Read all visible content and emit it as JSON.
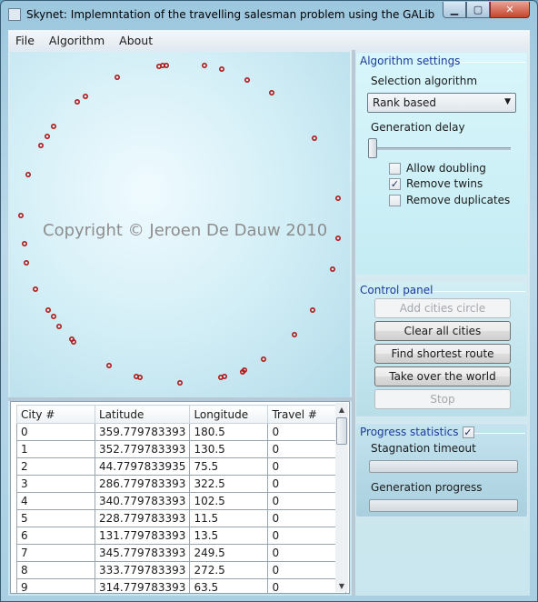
{
  "window": {
    "title": "Skynet: Implemntation of the travelling salesman problem using the GALib",
    "minimize": "▁",
    "maximize": "▢",
    "close": "✕"
  },
  "menu": [
    "File",
    "Algorithm",
    "About"
  ],
  "map": {
    "watermark": "Copyright © Jeroen De Dauw 2010",
    "city_color": "#b01818"
  },
  "table": {
    "headers": [
      "City #",
      "Latitude",
      "Longitude",
      "Travel #"
    ],
    "rows": [
      [
        "0",
        "359.779783393",
        "180.5",
        "0"
      ],
      [
        "1",
        "352.779783393",
        "130.5",
        "0"
      ],
      [
        "2",
        "44.7797833935",
        "75.5",
        "0"
      ],
      [
        "3",
        "286.779783393",
        "322.5",
        "0"
      ],
      [
        "4",
        "340.779783393",
        "102.5",
        "0"
      ],
      [
        "5",
        "228.779783393",
        "11.5",
        "0"
      ],
      [
        "6",
        "131.779783393",
        "13.5",
        "0"
      ],
      [
        "7",
        "345.779783393",
        "249.5",
        "0"
      ],
      [
        "8",
        "333.779783393",
        "272.5",
        "0"
      ],
      [
        "9",
        "314.779783393",
        "63.5",
        "0"
      ]
    ]
  },
  "settings": {
    "legend": "Algorithm settings",
    "selection_label": "Selection algorithm",
    "selection_value": "Rank based",
    "delay_label": "Generation delay",
    "delay_value": 0,
    "allow_doubling": {
      "label": "Allow doubling",
      "checked": false
    },
    "remove_twins": {
      "label": "Remove twins",
      "checked": true
    },
    "remove_duplicates": {
      "label": "Remove duplicates",
      "checked": false
    }
  },
  "control": {
    "legend": "Control panel",
    "add_circle": "Add cities circle",
    "clear": "Clear all cities",
    "find": "Find shortest route",
    "take_over": "Take over the world",
    "stop": "Stop"
  },
  "progress": {
    "legend": "Progress statistics",
    "legend_checked": true,
    "stagnation_label": "Stagnation timeout",
    "stagnation_value": 0,
    "generation_label": "Generation progress",
    "generation_value": 0
  }
}
